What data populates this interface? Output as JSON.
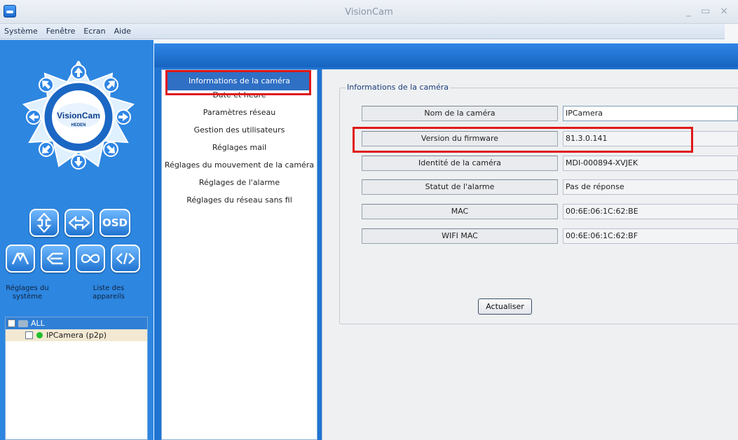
{
  "window": {
    "title": "VisionCam",
    "controls": [
      "_",
      "▭",
      "×"
    ]
  },
  "menu": [
    "Système",
    "Fenêtre",
    "Ecran",
    "Aide"
  ],
  "left_panel": {
    "logo_text": "VisionCam",
    "logo_subtext": "HEDEN",
    "buttons": [
      "vertical-flip",
      "horizontal-flip",
      "OSD",
      "patrol",
      "back",
      "loop",
      "code"
    ],
    "osd_label": "OSD",
    "labels": {
      "system_settings": "Réglages du système",
      "device_list": "Liste des appareils"
    },
    "device_tree": {
      "group": "ALL",
      "device": "IPCamera (p2p)"
    }
  },
  "nav": {
    "items": [
      "Informations de la caméra",
      "Date et heure",
      "Paramètres réseau",
      "Gestion des utilisateurs",
      "Réglages mail",
      "Réglages du mouvement de la caméra",
      "Réglages de l'alarme",
      "Réglages du réseau sans fil"
    ],
    "active_index": 0
  },
  "camera_info": {
    "group_title": "Informations de la caméra",
    "rows": [
      {
        "label": "Nom de la caméra",
        "value": "IPCamera"
      },
      {
        "label": "Version du firmware",
        "value": "81.3.0.141"
      },
      {
        "label": "Identité de la caméra",
        "value": "MDI-000894-XVJEK"
      },
      {
        "label": "Statut de l'alarme",
        "value": "Pas de réponse"
      },
      {
        "label": "MAC",
        "value": "00:6E:06:1C:62:BE"
      },
      {
        "label": "WIFI MAC",
        "value": "00:6E:06:1C:62:BF"
      }
    ],
    "refresh_label": "Actualiser"
  },
  "colors": {
    "panel_blue": "#2d86e0",
    "nav_active": "#2f6fc4",
    "highlight_red": "#e01818"
  }
}
